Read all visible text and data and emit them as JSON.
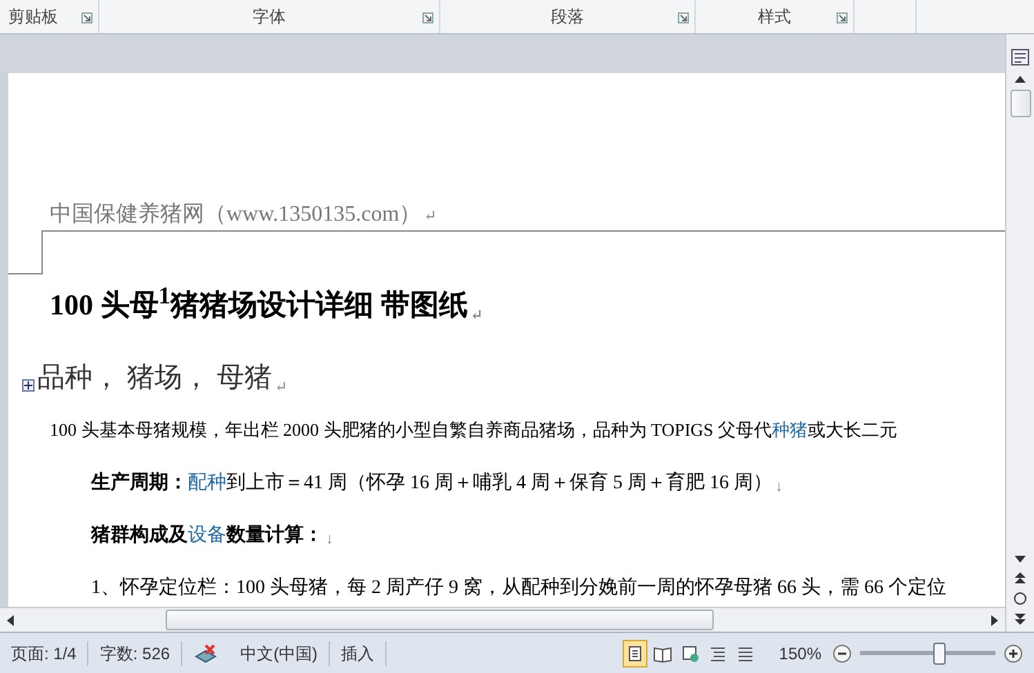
{
  "ribbon_groups": [
    {
      "label": "剪贴板"
    },
    {
      "label": "字体"
    },
    {
      "label": "段落"
    },
    {
      "label": "样式"
    }
  ],
  "document": {
    "header": {
      "text": "中国保健养猪网（www.1350135.com）",
      "mark": "↵"
    },
    "paragraphs": [
      {
        "kind": "title",
        "runs": [
          {
            "kind": "plain",
            "text": "100 头母$^{1}$猪猪场设计详细 带图纸"
          }
        ],
        "mark": "↵"
      },
      {
        "kind": "subtitle",
        "runs": [
          {
            "kind": "plain",
            "text": "品种， 猪场， 母猪"
          }
        ],
        "mark": "↵"
      },
      {
        "kind": "body",
        "runs": [
          {
            "kind": "plain",
            "text": "100 头基本母猪规模，年出栏 2000 头肥猪的小型自繁自养商品猪场，品种为 TOPIGS 父母代"
          },
          {
            "kind": "link",
            "text": "种猪"
          },
          {
            "kind": "plain",
            "text": "或大长二元"
          }
        ]
      },
      {
        "kind": "indented",
        "runs": [
          {
            "kind": "bold",
            "text": "生产周期："
          },
          {
            "kind": "link",
            "text": "配种"
          },
          {
            "kind": "plain",
            "text": "到上市＝41 周（怀孕 16 周＋哺乳 4 周＋保育 5 周＋育肥 16 周）"
          }
        ],
        "mark": "↓"
      },
      {
        "kind": "indented",
        "runs": [
          {
            "kind": "bold",
            "text": "猪群构成及"
          },
          {
            "kind": "link",
            "text": "设备"
          },
          {
            "kind": "bold",
            "text": "数量计算："
          }
        ],
        "mark": "↓"
      },
      {
        "kind": "indented",
        "runs": [
          {
            "kind": "plain",
            "text": "1、怀孕定位栏：100 头母猪，每 2 周产仔 9 窝，从配种到分娩前一周的怀孕母猪 66 头，需 66 个定位"
          }
        ]
      }
    ]
  },
  "status_bar": {
    "page": "页面: 1/4",
    "words": "字数: 526",
    "language": "中文(中国)",
    "mode": "插入",
    "views": [
      {
        "selected": true
      },
      {
        "selected": false
      },
      {
        "selected": false
      },
      {
        "selected": false
      },
      {
        "selected": false
      }
    ],
    "zoom": "150%",
    "zoom_slider": {
      "level": 0.58
    }
  }
}
